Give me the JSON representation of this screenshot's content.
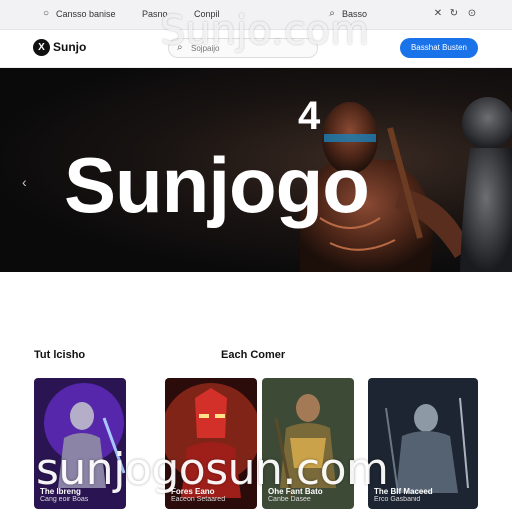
{
  "browser": {
    "left_label": "Cansso banise",
    "mid_label1": "Pasno",
    "mid_label2": "Conpil",
    "right_label": "Basso",
    "icons": [
      "circle-icon",
      "search-icon",
      "close-icon",
      "refresh-icon",
      "menu-icon"
    ]
  },
  "header": {
    "logo_mark": "X",
    "logo_text": "Sunjo",
    "search_placeholder": "Sojpaijo",
    "cta_label": "Basshat Busten"
  },
  "hero": {
    "title": "Sunjogo",
    "number": "4",
    "arrow": "‹"
  },
  "sections": {
    "left_title": "Tut lcisho",
    "right_title": "Each Comer"
  },
  "cards": [
    {
      "title": "The Ibreng",
      "sub": "Cang eoir Boas",
      "bg": "#3c1f6e",
      "accent": "#8a3cf0"
    },
    {
      "title": "Fores Eano",
      "sub": "Eaceon Setaared",
      "bg": "#3a0e0e",
      "accent": "#d8342a"
    },
    {
      "title": "Ohe Fant Bato",
      "sub": "Canbe Dasee",
      "bg": "#2d3a2a",
      "accent": "#c9a24a"
    },
    {
      "title": "The Blf Maceed",
      "sub": "Erco Gasbanid",
      "bg": "#1f2a36",
      "accent": "#7c8a99"
    }
  ],
  "watermark": {
    "main": "sunjogosun.com",
    "top": "Sunjo.com"
  },
  "colors": {
    "accent": "#1a73e8",
    "hero_bg": "#0a0a0b"
  }
}
